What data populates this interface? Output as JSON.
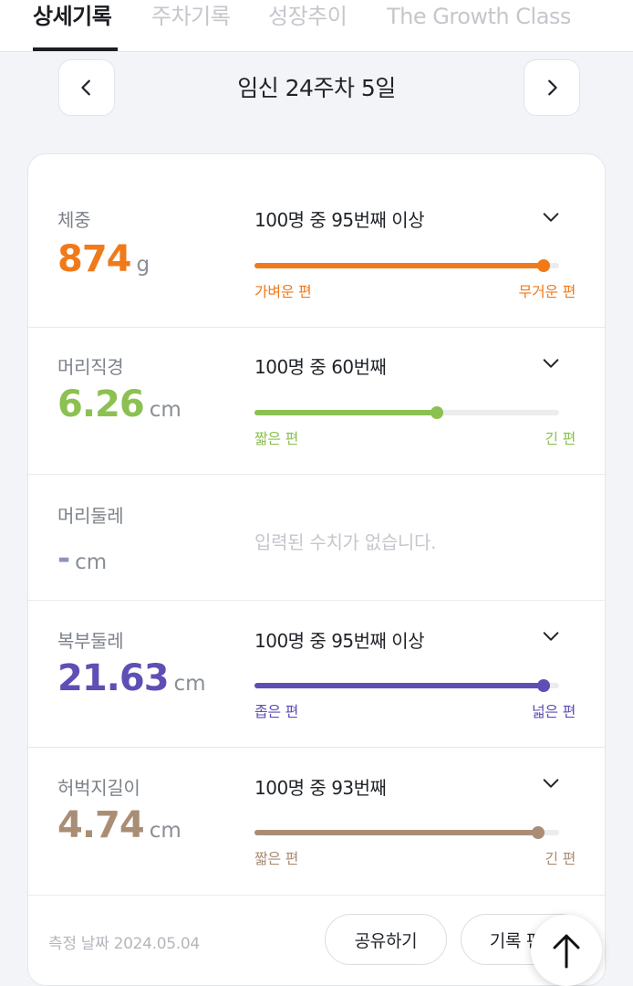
{
  "tabs": [
    {
      "label": "상세기록",
      "active": true
    },
    {
      "label": "주차기록",
      "active": false
    },
    {
      "label": "성장추이",
      "active": false
    },
    {
      "label": "The Growth Class",
      "active": false
    }
  ],
  "week_nav": {
    "title": "임신 24주차 5일",
    "prev_icon": "chevron-left-icon",
    "next_icon": "chevron-right-icon"
  },
  "measurements": [
    {
      "name": "체중",
      "value": "874",
      "unit": "g",
      "rank": "100명 중 95번째 이상",
      "percentile": 0.95,
      "low_label": "가벼운 편",
      "high_label": "무거운 편",
      "color": "#f07a1a"
    },
    {
      "name": "머리직경",
      "value": "6.26",
      "unit": "cm",
      "rank": "100명 중 60번째",
      "percentile": 0.6,
      "low_label": "짧은 편",
      "high_label": "긴 편",
      "color": "#8cc152"
    },
    {
      "name": "머리둘레",
      "value": "-",
      "unit": "cm",
      "empty_text": "입력된 수치가 없습니다.",
      "color": "#8a94b8"
    },
    {
      "name": "복부둘레",
      "value": "21.63",
      "unit": "cm",
      "rank": "100명 중 95번째 이상",
      "percentile": 0.95,
      "low_label": "좁은 편",
      "high_label": "넓은 편",
      "color": "#5e4fb5"
    },
    {
      "name": "허벅지길이",
      "value": "4.74",
      "unit": "cm",
      "rank": "100명 중 93번째",
      "percentile": 0.93,
      "low_label": "짧은 편",
      "high_label": "긴 편",
      "color": "#a98e75"
    }
  ],
  "footer": {
    "measured_date": "측정 날짜 2024.05.04",
    "share_label": "공유하기",
    "edit_label": "기록 편집"
  },
  "fab": {
    "icon": "arrow-up-icon"
  }
}
